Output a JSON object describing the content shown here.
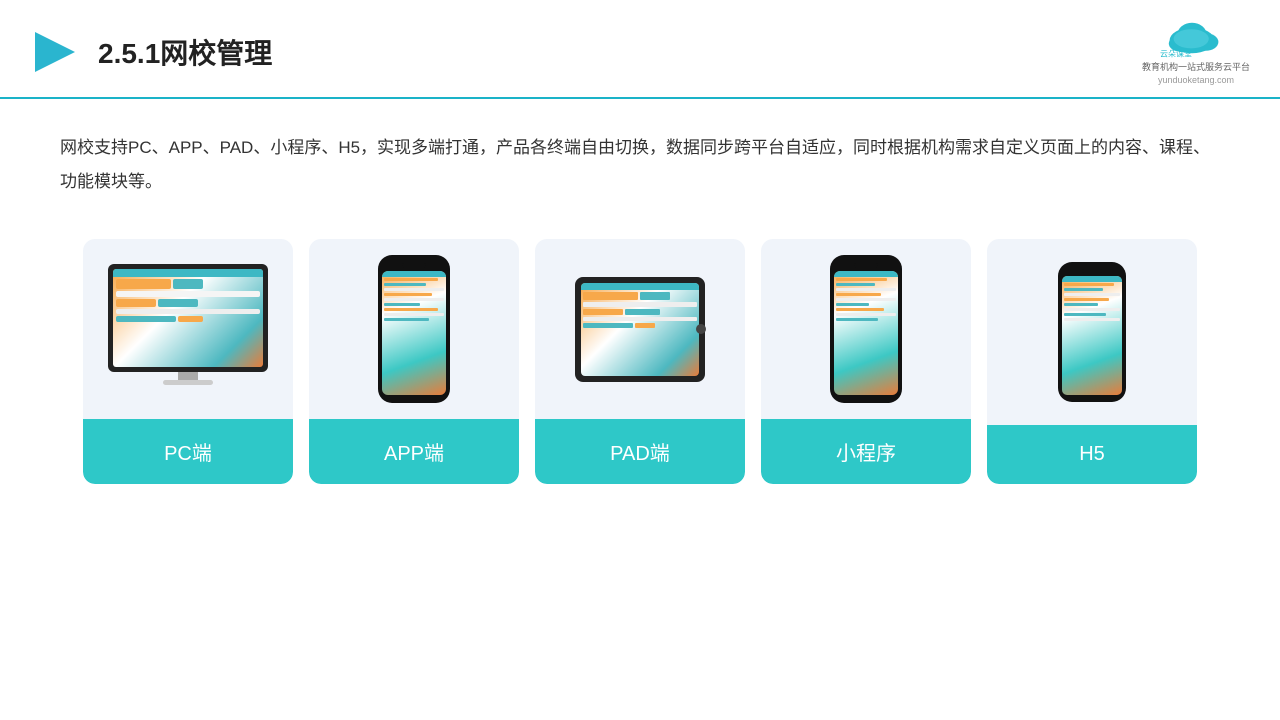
{
  "header": {
    "title": "2.5.1网校管理",
    "logo_url": "yunduoketang.com",
    "logo_text": "云朵课堂",
    "logo_subtitle": "教育机构一站式服务云平台"
  },
  "description": {
    "text": "网校支持PC、APP、PAD、小程序、H5，实现多端打通，产品各终端自由切换，数据同步跨平台自适应，同时根据机构需求自定义页面上的内容、课程、功能模块等。"
  },
  "cards": [
    {
      "id": "pc",
      "label": "PC端"
    },
    {
      "id": "app",
      "label": "APP端"
    },
    {
      "id": "pad",
      "label": "PAD端"
    },
    {
      "id": "miniprogram",
      "label": "小程序"
    },
    {
      "id": "h5",
      "label": "H5"
    }
  ],
  "colors": {
    "teal": "#2ec8c8",
    "accent_orange": "#f7a84a",
    "dark_text": "#222222",
    "bg_card": "#f0f4fa",
    "border_bottom": "#1ab3c8"
  }
}
